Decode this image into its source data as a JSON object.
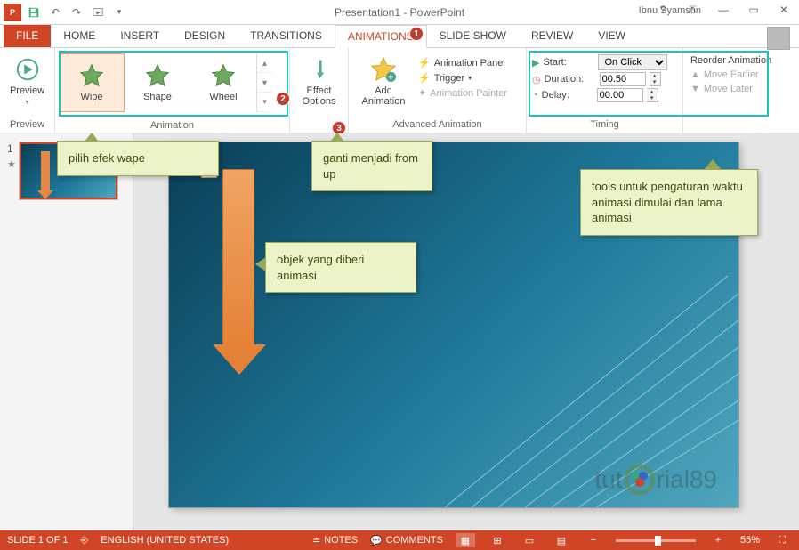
{
  "title": "Presentation1 - PowerPoint",
  "user_name": "Ibnu Syamsun",
  "tabs": {
    "file": "FILE",
    "home": "HOME",
    "insert": "INSERT",
    "design": "DESIGN",
    "transitions": "TRANSITIONS",
    "animations": "ANIMATIONS",
    "slideshow": "SLIDE SHOW",
    "review": "REVIEW",
    "view": "VIEW"
  },
  "ribbon": {
    "preview": {
      "btn": "Preview",
      "group": "Preview"
    },
    "animation": {
      "items": {
        "wipe": "Wipe",
        "shape": "Shape",
        "wheel": "Wheel"
      },
      "group": "Animation"
    },
    "effect_options": "Effect\nOptions",
    "advanced": {
      "add": "Add\nAnimation",
      "pane": "Animation Pane",
      "trigger": "Trigger",
      "painter": "Animation Painter",
      "group": "Advanced Animation"
    },
    "timing": {
      "start_lbl": "Start:",
      "start_val": "On Click",
      "duration_lbl": "Duration:",
      "duration_val": "00.50",
      "delay_lbl": "Delay:",
      "delay_val": "00.00",
      "reorder": "Reorder Animation",
      "earlier": "Move Earlier",
      "later": "Move Later",
      "group": "Timing"
    }
  },
  "slide": {
    "number": "1",
    "anim_tag": "1"
  },
  "callouts": {
    "c1": "pilih efek wape",
    "c2": "ganti menjadi from up",
    "c3": "objek yang diberi animasi",
    "c4": "tools untuk pengaturan waktu animasi dimulai dan lama animasi"
  },
  "watermark": {
    "pre": "tut",
    "post": "rial89"
  },
  "status": {
    "slide": "SLIDE 1 OF 1",
    "lang": "ENGLISH (UNITED STATES)",
    "notes": "NOTES",
    "comments": "COMMENTS",
    "zoom": "55%"
  }
}
